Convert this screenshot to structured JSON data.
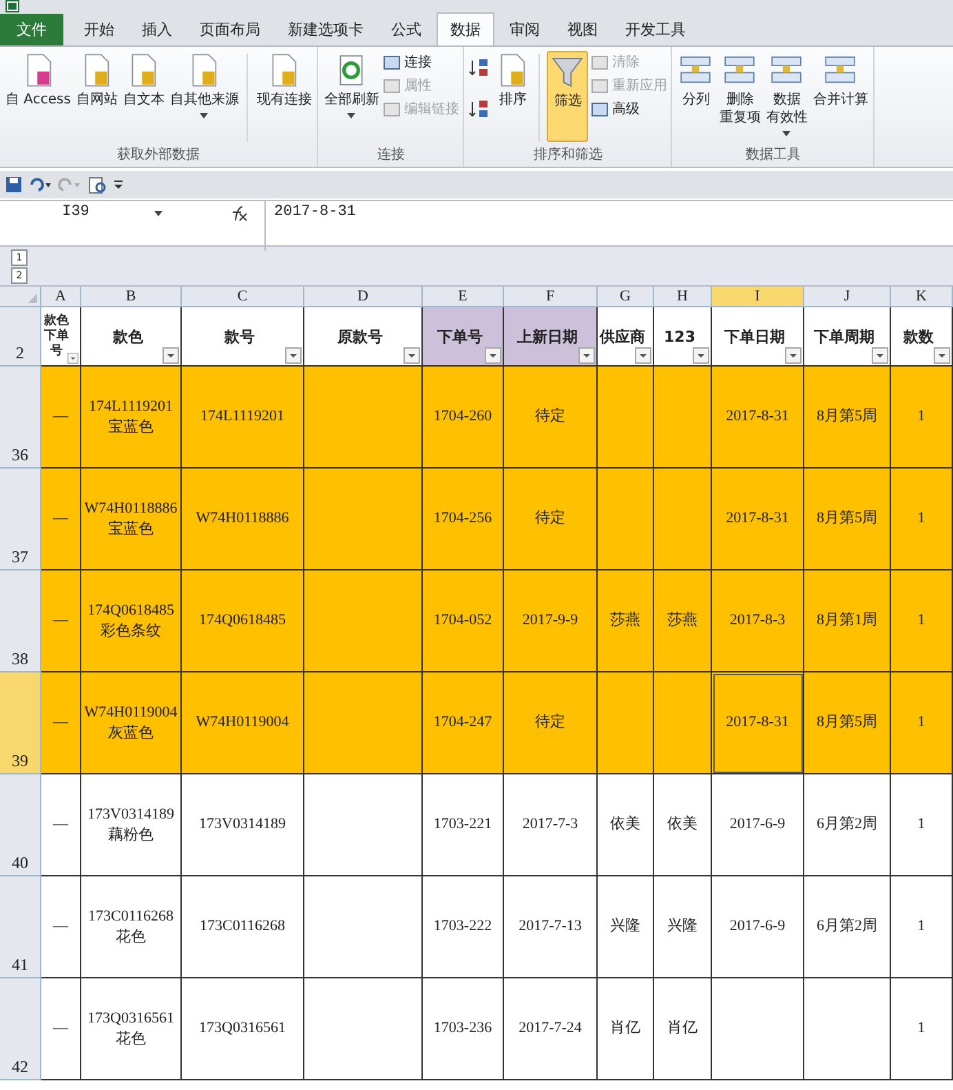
{
  "tabs": [
    {
      "label": "文件",
      "kind": "file",
      "selected": false
    },
    {
      "label": "开始",
      "kind": "tab",
      "selected": false
    },
    {
      "label": "插入",
      "kind": "tab",
      "selected": false
    },
    {
      "label": "页面布局",
      "kind": "tab",
      "selected": false
    },
    {
      "label": "新建选项卡",
      "kind": "tab",
      "selected": false
    },
    {
      "label": "公式",
      "kind": "tab",
      "selected": false
    },
    {
      "label": "数据",
      "kind": "tab",
      "selected": true
    },
    {
      "label": "审阅",
      "kind": "tab",
      "selected": false
    },
    {
      "label": "视图",
      "kind": "tab",
      "selected": false
    },
    {
      "label": "开发工具",
      "kind": "tab",
      "selected": false
    }
  ],
  "ribbon": {
    "groups": [
      {
        "label": "获取外部数据",
        "items": [
          {
            "kind": "large",
            "label": "自 Access",
            "dropdown": false,
            "disabled": false,
            "active": false
          },
          {
            "kind": "large",
            "label": "自网站",
            "dropdown": false,
            "disabled": false,
            "active": false
          },
          {
            "kind": "large",
            "label": "自文本",
            "dropdown": false,
            "disabled": false,
            "active": false
          },
          {
            "kind": "large",
            "label": "自其他来源",
            "dropdown": true,
            "disabled": false,
            "active": false
          },
          {
            "kind": "separator"
          },
          {
            "kind": "large",
            "label": "现有连接",
            "dropdown": false,
            "disabled": false,
            "active": false
          }
        ]
      },
      {
        "label": "连接",
        "items": [
          {
            "kind": "large",
            "label": "全部刷新",
            "dropdown": true,
            "disabled": false,
            "active": false
          },
          {
            "kind": "stack",
            "children": [
              {
                "label": "连接",
                "disabled": false
              },
              {
                "label": "属性",
                "disabled": true
              },
              {
                "label": "编辑链接",
                "disabled": true
              }
            ]
          }
        ]
      },
      {
        "label": "排序和筛选",
        "items": [
          {
            "kind": "sortpair"
          },
          {
            "kind": "large",
            "label": "排序",
            "dropdown": false,
            "disabled": false,
            "active": false
          },
          {
            "kind": "separator"
          },
          {
            "kind": "large",
            "label": "筛选",
            "dropdown": false,
            "disabled": false,
            "active": true
          },
          {
            "kind": "stack",
            "children": [
              {
                "label": "清除",
                "disabled": true
              },
              {
                "label": "重新应用",
                "disabled": true
              },
              {
                "label": "高级",
                "disabled": false
              }
            ]
          }
        ]
      },
      {
        "label": "数据工具",
        "items": [
          {
            "kind": "large",
            "label": "分列",
            "dropdown": false,
            "disabled": false,
            "active": false
          },
          {
            "kind": "large",
            "label": [
              "删除",
              "重复项"
            ],
            "dropdown": false,
            "disabled": false,
            "active": false
          },
          {
            "kind": "large",
            "label": [
              "数据",
              "有效性"
            ],
            "dropdown": true,
            "disabled": false,
            "active": false
          },
          {
            "kind": "large",
            "label": "合并计算",
            "dropdown": false,
            "disabled": false,
            "active": false
          }
        ]
      }
    ]
  },
  "formula_bar": {
    "name_box": "I39",
    "value": "2017-8-31"
  },
  "outline_levels": [
    "1",
    "2"
  ],
  "columns": [
    {
      "letter": "A",
      "header": "款色下单号",
      "color": "#ffffff",
      "selected": false
    },
    {
      "letter": "B",
      "header": "款色",
      "color": "#ffffff",
      "selected": false
    },
    {
      "letter": "C",
      "header": "款号",
      "color": "#ffffff",
      "selected": false
    },
    {
      "letter": "D",
      "header": "原款号",
      "color": "#ffffff",
      "selected": false
    },
    {
      "letter": "E",
      "header": "下单号",
      "color": "#ccc0da",
      "selected": false
    },
    {
      "letter": "F",
      "header": "上新日期",
      "color": "#ccc0da",
      "selected": false
    },
    {
      "letter": "G",
      "header": "供应商",
      "color": "#ffffff",
      "selected": false
    },
    {
      "letter": "H",
      "header": "123",
      "color": "#ffffff",
      "selected": false
    },
    {
      "letter": "I",
      "header": "下单日期",
      "color": "#ffffff",
      "selected": true
    },
    {
      "letter": "J",
      "header": "下单周期",
      "color": "#ffffff",
      "selected": false
    },
    {
      "letter": "K",
      "header": "款数",
      "color": "#ffffff",
      "selected": false
    }
  ],
  "header_row_number": "2",
  "rows": [
    {
      "number": "36",
      "highlighted": true,
      "selected": false,
      "cells": {
        "A": "—",
        "B": "174L1119201\n宝蓝色",
        "C": "174L1119201",
        "E": "1704-260",
        "F": "待定",
        "I": "2017-8-31",
        "J": "8月第5周",
        "K": "1"
      }
    },
    {
      "number": "37",
      "highlighted": true,
      "selected": false,
      "cells": {
        "A": "—",
        "B": "W74H0118886\n宝蓝色",
        "C": "W74H0118886",
        "E": "1704-256",
        "F": "待定",
        "I": "2017-8-31",
        "J": "8月第5周",
        "K": "1"
      }
    },
    {
      "number": "38",
      "highlighted": true,
      "selected": false,
      "cells": {
        "A": "—",
        "B": "174Q0618485\n彩色条纹",
        "C": "174Q0618485",
        "E": "1704-052",
        "F": "2017-9-9",
        "G": "莎燕",
        "H": "莎燕",
        "I": "2017-8-3",
        "J": "8月第1周",
        "K": "1"
      }
    },
    {
      "number": "39",
      "highlighted": true,
      "selected": true,
      "cells": {
        "A": "—",
        "B": "W74H0119004\n灰蓝色",
        "C": "W74H0119004",
        "E": "1704-247",
        "F": "待定",
        "I": "2017-8-31",
        "J": "8月第5周",
        "K": "1"
      }
    },
    {
      "number": "40",
      "highlighted": false,
      "selected": false,
      "cells": {
        "A": "—",
        "B": "173V0314189\n藕粉色",
        "C": "173V0314189",
        "E": "1703-221",
        "F": "2017-7-3",
        "G": "依美",
        "H": "依美",
        "I": "2017-6-9",
        "J": "6月第2周",
        "K": "1"
      }
    },
    {
      "number": "41",
      "highlighted": false,
      "selected": false,
      "cells": {
        "A": "—",
        "B": "173C0116268\n花色",
        "C": "173C0116268",
        "E": "1703-222",
        "F": "2017-7-13",
        "G": "兴隆",
        "H": "兴隆",
        "I": "2017-6-9",
        "J": "6月第2周",
        "K": "1"
      }
    },
    {
      "number": "42",
      "highlighted": false,
      "selected": false,
      "cells": {
        "A": "—",
        "B": "173Q0316561\n花色",
        "C": "173Q0316561",
        "E": "1703-236",
        "F": "2017-7-24",
        "G": "肖亿",
        "H": "肖亿",
        "K": "1"
      }
    }
  ]
}
